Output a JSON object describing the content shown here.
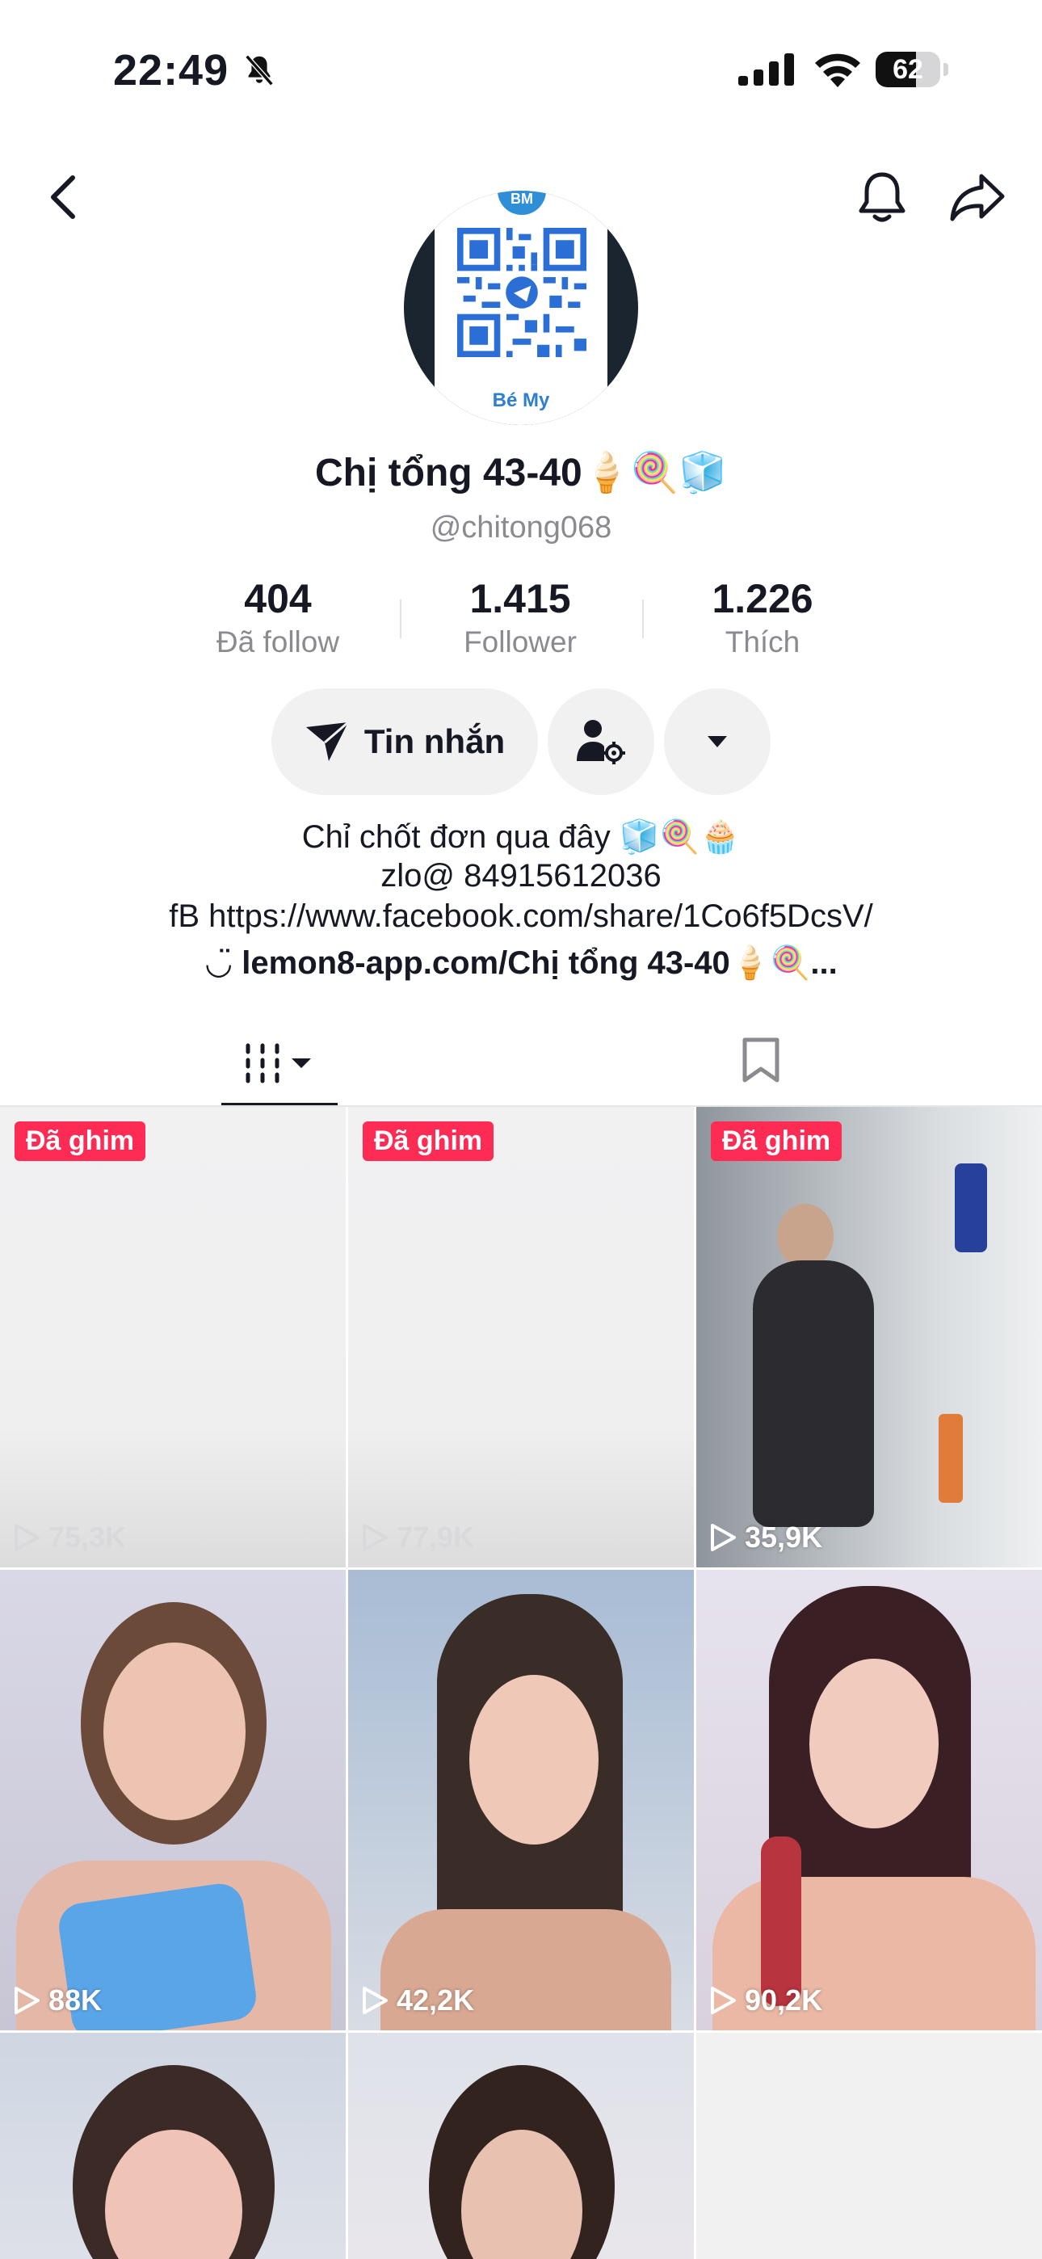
{
  "status_bar": {
    "time": "22:49",
    "battery": "62",
    "battery_level": 0.62
  },
  "profile": {
    "display_name": "Chị tổng 43-40🍦🍭🧊",
    "username": "@chitong068",
    "avatar_caption": "Bé My",
    "avatar_badge": "BM",
    "stats": {
      "following": {
        "value": "404",
        "label": "Đã follow"
      },
      "followers": {
        "value": "1.415",
        "label": "Follower"
      },
      "likes": {
        "value": "1.226",
        "label": "Thích"
      }
    },
    "message_label": "Tin nhắn",
    "bio": [
      "Chỉ chốt đơn qua đây 🧊🍭🧁",
      "zlo@ 84915612036",
      "fB    https://www.facebook.com/share/1Co6f5DcsV/"
    ],
    "link": "lemon8-app.com/Chị tổng 43-40🍦🍭..."
  },
  "icons": {
    "back": "chevron-left-icon",
    "notify": "bell-icon",
    "share": "share-arrow-icon",
    "message": "paper-plane-icon",
    "friends": "person-settings-icon",
    "more": "caret-down-icon",
    "videos_tab": "grid-icon",
    "saved_tab": "bookmark-icon",
    "views": "play-icon"
  },
  "colors": {
    "accent": "#fe2c55",
    "text": "#161823",
    "muted": "#8a8b91"
  },
  "videos": [
    {
      "pinned_label": "Đã ghim",
      "views": "75,3K"
    },
    {
      "pinned_label": "Đã ghim",
      "views": "77,9K"
    },
    {
      "pinned_label": "Đã ghim",
      "views": "35,9K"
    },
    {
      "views": "88K"
    },
    {
      "views": "42,2K"
    },
    {
      "views": "90,2K"
    }
  ]
}
